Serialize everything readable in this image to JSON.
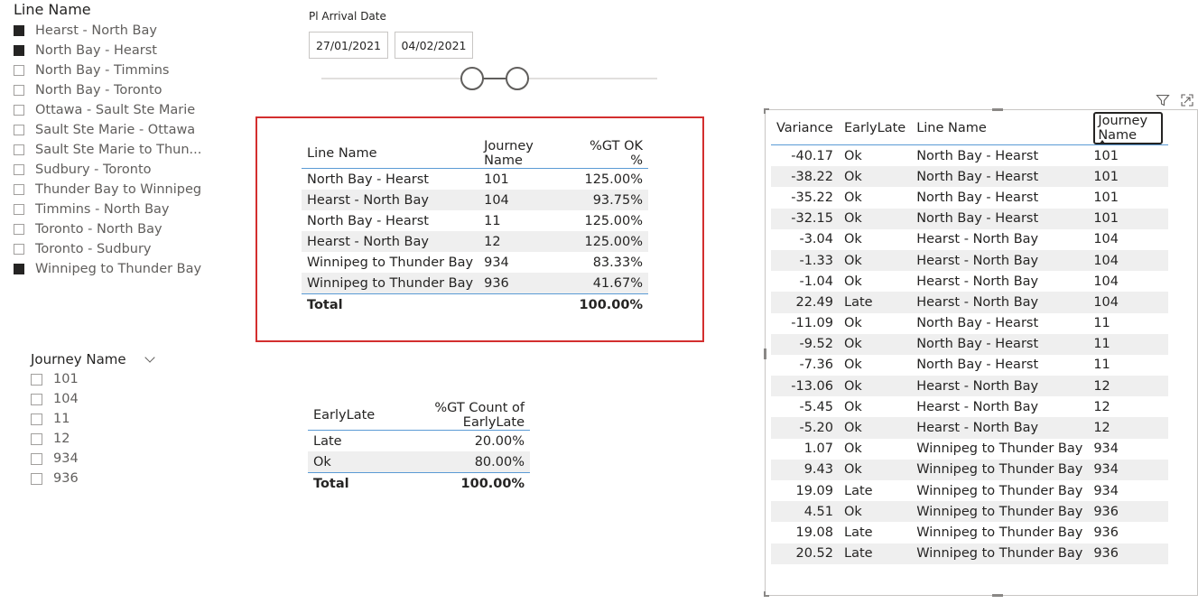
{
  "line_slicer": {
    "title": "Line Name",
    "items": [
      {
        "label": "Hearst - North Bay",
        "checked": true
      },
      {
        "label": "North Bay - Hearst",
        "checked": true
      },
      {
        "label": "North Bay - Timmins",
        "checked": false
      },
      {
        "label": "North Bay - Toronto",
        "checked": false
      },
      {
        "label": "Ottawa - Sault Ste Marie",
        "checked": false
      },
      {
        "label": "Sault Ste Marie - Ottawa",
        "checked": false
      },
      {
        "label": "Sault Ste Marie to Thun...",
        "checked": false
      },
      {
        "label": "Sudbury - Toronto",
        "checked": false
      },
      {
        "label": "Thunder Bay to Winnipeg",
        "checked": false
      },
      {
        "label": "Timmins - North Bay",
        "checked": false
      },
      {
        "label": "Toronto - North Bay",
        "checked": false
      },
      {
        "label": "Toronto - Sudbury",
        "checked": false
      },
      {
        "label": "Winnipeg to Thunder Bay",
        "checked": true
      }
    ]
  },
  "journey_slicer": {
    "title": "Journey Name",
    "items": [
      "101",
      "104",
      "11",
      "12",
      "934",
      "936"
    ]
  },
  "date_slicer": {
    "title": "Pl Arrival Date",
    "start": "27/01/2021",
    "end": "04/02/2021"
  },
  "gt_table": {
    "headers": [
      "Line Name",
      "Journey Name",
      "%GT OK %"
    ],
    "rows": [
      [
        "North Bay - Hearst",
        "101",
        "125.00%"
      ],
      [
        "Hearst - North Bay",
        "104",
        "93.75%"
      ],
      [
        "North Bay - Hearst",
        "11",
        "125.00%"
      ],
      [
        "Hearst - North Bay",
        "12",
        "125.00%"
      ],
      [
        "Winnipeg to Thunder Bay",
        "934",
        "83.33%"
      ],
      [
        "Winnipeg to Thunder Bay",
        "936",
        "41.67%"
      ]
    ],
    "total_label": "Total",
    "total_value": "100.00%"
  },
  "earlylate_table": {
    "headers": [
      "EarlyLate",
      "%GT Count of EarlyLate"
    ],
    "rows": [
      [
        "Late",
        "20.00%"
      ],
      [
        "Ok",
        "80.00%"
      ]
    ],
    "total_label": "Total",
    "total_value": "100.00%"
  },
  "detail_table": {
    "headers": [
      "Variance",
      "EarlyLate",
      "Line Name",
      "Journey Name"
    ],
    "rows": [
      [
        "-40.17",
        "Ok",
        "North Bay - Hearst",
        "101"
      ],
      [
        "-38.22",
        "Ok",
        "North Bay - Hearst",
        "101"
      ],
      [
        "-35.22",
        "Ok",
        "North Bay - Hearst",
        "101"
      ],
      [
        "-32.15",
        "Ok",
        "North Bay - Hearst",
        "101"
      ],
      [
        "-3.04",
        "Ok",
        "Hearst - North Bay",
        "104"
      ],
      [
        "-1.33",
        "Ok",
        "Hearst - North Bay",
        "104"
      ],
      [
        "-1.04",
        "Ok",
        "Hearst - North Bay",
        "104"
      ],
      [
        "22.49",
        "Late",
        "Hearst - North Bay",
        "104"
      ],
      [
        "-11.09",
        "Ok",
        "North Bay - Hearst",
        "11"
      ],
      [
        "-9.52",
        "Ok",
        "North Bay - Hearst",
        "11"
      ],
      [
        "-7.36",
        "Ok",
        "North Bay - Hearst",
        "11"
      ],
      [
        "-13.06",
        "Ok",
        "Hearst - North Bay",
        "12"
      ],
      [
        "-5.45",
        "Ok",
        "Hearst - North Bay",
        "12"
      ],
      [
        "-5.20",
        "Ok",
        "Hearst - North Bay",
        "12"
      ],
      [
        "1.07",
        "Ok",
        "Winnipeg to Thunder Bay",
        "934"
      ],
      [
        "9.43",
        "Ok",
        "Winnipeg to Thunder Bay",
        "934"
      ],
      [
        "19.09",
        "Late",
        "Winnipeg to Thunder Bay",
        "934"
      ],
      [
        "4.51",
        "Ok",
        "Winnipeg to Thunder Bay",
        "936"
      ],
      [
        "19.08",
        "Late",
        "Winnipeg to Thunder Bay",
        "936"
      ],
      [
        "20.52",
        "Late",
        "Winnipeg to Thunder Bay",
        "936"
      ]
    ]
  },
  "icons": {
    "filter": "filter-icon",
    "focus": "focus-mode-icon"
  },
  "colors": {
    "accent": "#5b9bd5",
    "highlight_border": "#d32f2f",
    "alt_row": "#efefef",
    "text": "#252423"
  }
}
